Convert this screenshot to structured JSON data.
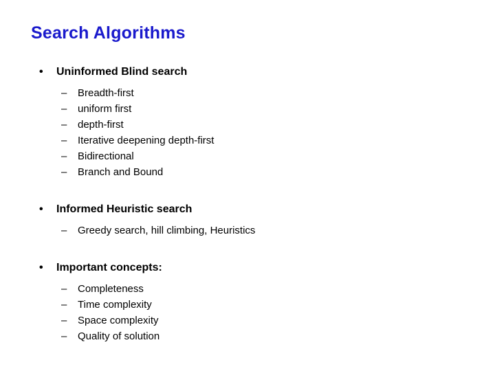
{
  "slide": {
    "title": "Search Algorithms",
    "title_color": "#1a1acc",
    "body_color": "#000000",
    "background_color": "#ffffff",
    "bullet_marker": "•",
    "sub_bullet_marker": "–",
    "groups": [
      {
        "heading": "Uninformed Blind search",
        "items": [
          "Breadth-first",
          "uniform first",
          "depth-first",
          "Iterative deepening depth-first",
          "Bidirectional",
          "Branch and Bound"
        ]
      },
      {
        "heading": "Informed Heuristic search",
        "items": [
          "Greedy search, hill climbing, Heuristics"
        ]
      },
      {
        "heading": "Important concepts:",
        "items": [
          "Completeness",
          "Time complexity",
          "Space complexity",
          "Quality of solution"
        ]
      }
    ]
  }
}
